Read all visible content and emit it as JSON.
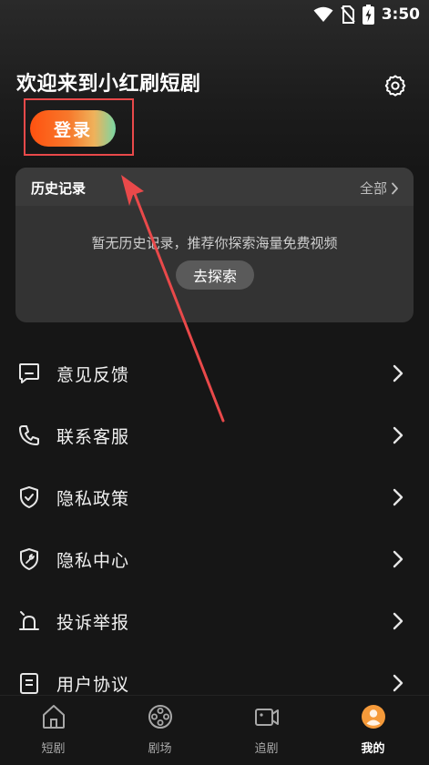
{
  "status_bar": {
    "time": "3:50",
    "icons": [
      "wifi-icon",
      "no-sim-icon",
      "battery-charging-icon"
    ]
  },
  "header": {
    "welcome_text": "欢迎来到小红刷短剧",
    "login_label": "登录",
    "settings_icon": "gear-icon"
  },
  "history": {
    "title": "历史记录",
    "all_label": "全部",
    "empty_text": "暂无历史记录，推荐你探索海量免费视频",
    "explore_label": "去探索"
  },
  "menu": [
    {
      "label": "意见反馈",
      "icon": "feedback-icon"
    },
    {
      "label": "联系客服",
      "icon": "phone-icon"
    },
    {
      "label": "隐私政策",
      "icon": "shield-check-icon"
    },
    {
      "label": "隐私中心",
      "icon": "shield-wrench-icon"
    },
    {
      "label": "投诉举报",
      "icon": "alarm-icon"
    },
    {
      "label": "用户协议",
      "icon": "document-icon"
    }
  ],
  "bottom_nav": [
    {
      "label": "短剧",
      "icon": "home-icon",
      "active": false
    },
    {
      "label": "剧场",
      "icon": "film-reel-icon",
      "active": false
    },
    {
      "label": "追剧",
      "icon": "video-camera-icon",
      "active": false
    },
    {
      "label": "我的",
      "icon": "avatar-icon",
      "active": true
    }
  ],
  "colors": {
    "background": "#161616",
    "card": "#333333",
    "login_gradient_start": "#ff5210",
    "login_gradient_end": "#79d7a4",
    "highlight_red": "#e9494a",
    "avatar_orange": "#f59a3a"
  }
}
